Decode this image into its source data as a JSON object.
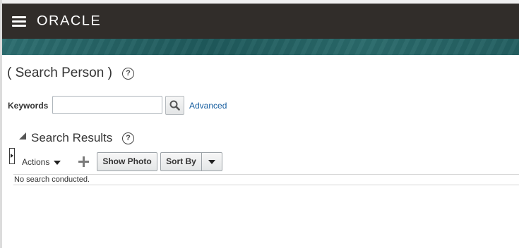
{
  "header": {
    "logo_text": "ORACLE"
  },
  "page": {
    "title": "( Search Person )"
  },
  "search": {
    "keywords_label": "Keywords",
    "keywords_value": "",
    "keywords_placeholder": "",
    "advanced_link": "Advanced"
  },
  "results": {
    "title": "Search Results",
    "toolbar": {
      "actions_label": "Actions",
      "show_photo_label": "Show Photo",
      "sort_by_label": "Sort By"
    },
    "empty_message": "No search conducted."
  },
  "icons": {
    "menu": "hamburger-menu-icon",
    "help": "help-icon",
    "search": "search-icon",
    "collapse": "collapse-triangle-icon",
    "add": "add-icon",
    "dropdown": "chevron-down-icon",
    "panel_toggle": "expand-panel-icon"
  },
  "colors": {
    "header_bg": "#312d2a",
    "banner_bg": "#2c6d6f",
    "link": "#145c9e"
  }
}
